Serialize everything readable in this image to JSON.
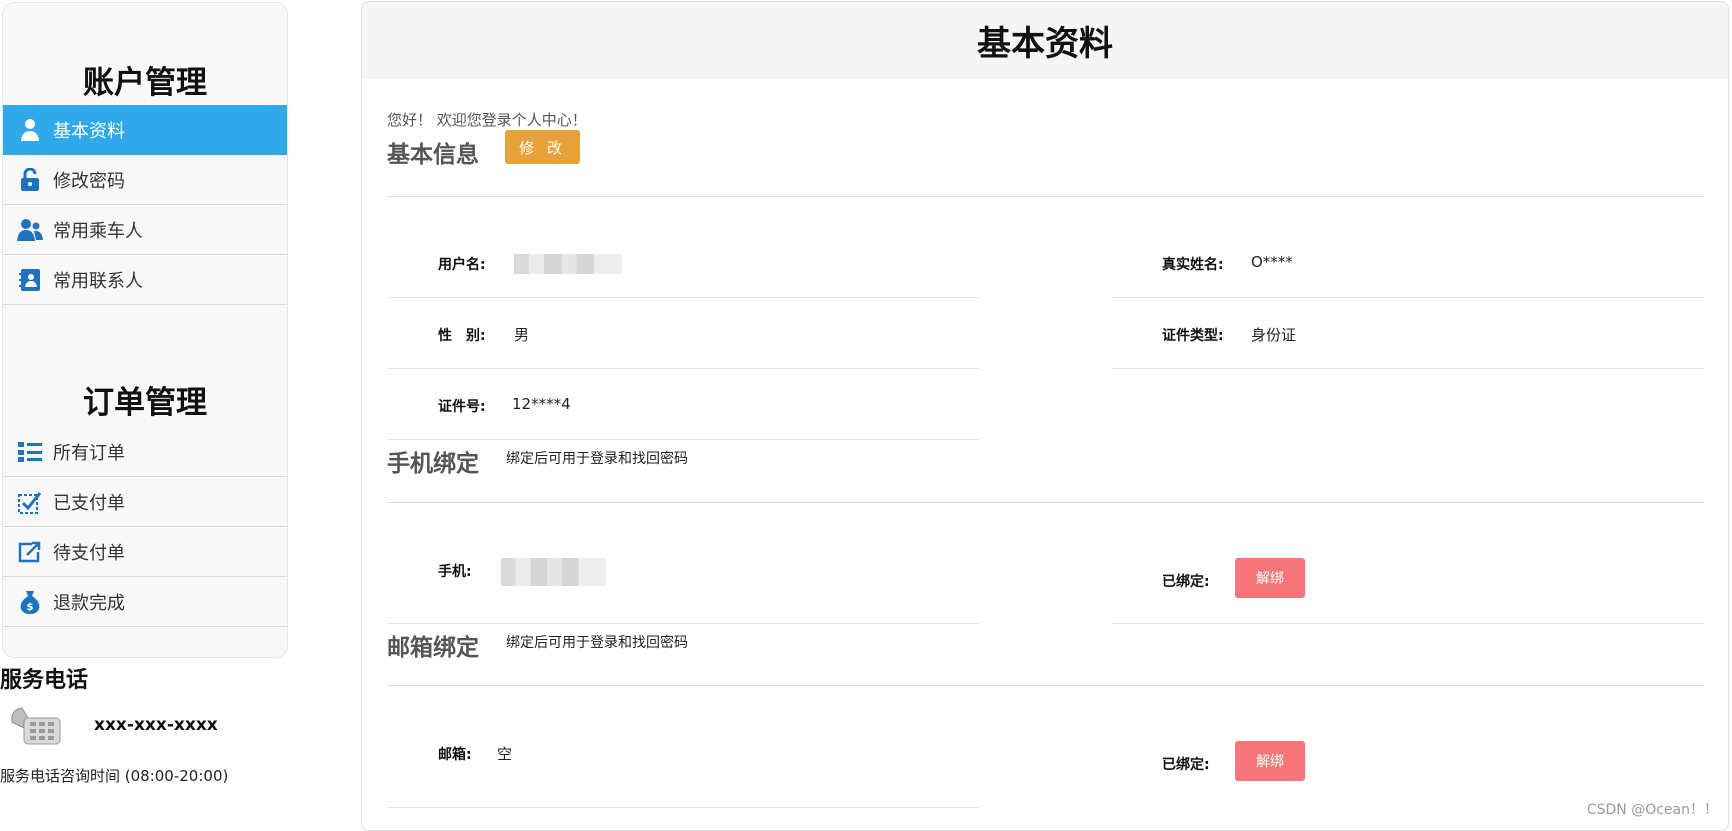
{
  "sidebar": {
    "account_title": "账户管理",
    "account_items": [
      {
        "label": "基本资料",
        "icon": "user-icon",
        "active": true
      },
      {
        "label": "修改密码",
        "icon": "unlock-icon",
        "active": false
      },
      {
        "label": "常用乘车人",
        "icon": "users-icon",
        "active": false
      },
      {
        "label": "常用联系人",
        "icon": "contact-book-icon",
        "active": false
      }
    ],
    "order_title": "订单管理",
    "order_items": [
      {
        "label": "所有订单",
        "icon": "list-icon"
      },
      {
        "label": "已支付单",
        "icon": "checked-box-icon"
      },
      {
        "label": "待支付单",
        "icon": "share-external-icon"
      },
      {
        "label": "退款完成",
        "icon": "money-bag-icon"
      }
    ],
    "service": {
      "title": "服务电话",
      "number": "xxx-xxx-xxxx",
      "hours": "服务电话咨询时间 (08:00-20:00)"
    }
  },
  "main": {
    "title": "基本资料",
    "welcome": "您好！ 欢迎您登录个人中心！",
    "basic": {
      "title": "基本信息",
      "edit_label": "修 改",
      "username_label": "用户名:",
      "realname_label": "真实姓名:",
      "realname_value": "O****",
      "gender_label": "性　别:",
      "gender_value": "男",
      "idtype_label": "证件类型:",
      "idtype_value": "身份证",
      "idno_label": "证件号:",
      "idno_value": "12****4"
    },
    "phone": {
      "title": "手机绑定",
      "hint": "绑定后可用于登录和找回密码",
      "label": "手机:",
      "status_label": "已绑定:",
      "unbind_label": "解绑"
    },
    "email": {
      "title": "邮箱绑定",
      "hint": "绑定后可用于登录和找回密码",
      "label": "邮箱:",
      "value": "空",
      "status_label": "已绑定:",
      "unbind_label": "解绑"
    }
  },
  "watermark": "CSDN @Ocean！！",
  "colors": {
    "active": "#2fa9e9",
    "edit": "#e8a23b",
    "unbind": "#f47679",
    "icon": "#1e73be"
  }
}
